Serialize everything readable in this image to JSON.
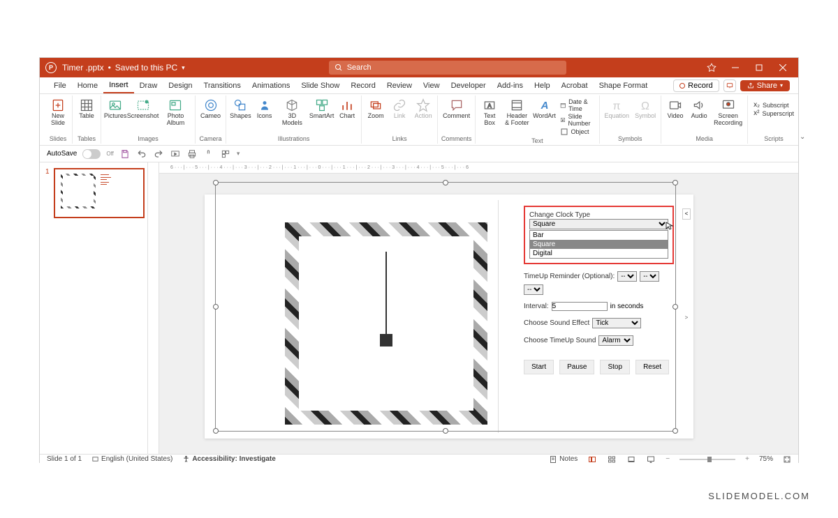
{
  "title": {
    "filename": "Timer .pptx",
    "saved": "Saved to this PC"
  },
  "search": {
    "placeholder": "Search"
  },
  "menu": {
    "file": "File",
    "home": "Home",
    "insert": "Insert",
    "draw": "Draw",
    "design": "Design",
    "transitions": "Transitions",
    "animations": "Animations",
    "slideshow": "Slide Show",
    "record": "Record",
    "review": "Review",
    "view": "View",
    "developer": "Developer",
    "addins": "Add-ins",
    "help": "Help",
    "acrobat": "Acrobat",
    "shapeformat": "Shape Format",
    "recordbtn": "Record",
    "share": "Share"
  },
  "ribbon": {
    "slides": {
      "newslide": "New\nSlide",
      "group": "Slides"
    },
    "tables": {
      "table": "Table",
      "group": "Tables"
    },
    "images": {
      "pictures": "Pictures",
      "screenshot": "Screenshot",
      "photoalbum": "Photo\nAlbum",
      "group": "Images"
    },
    "camera": {
      "cameo": "Cameo",
      "group": "Camera"
    },
    "illustrations": {
      "shapes": "Shapes",
      "icons": "Icons",
      "models": "3D\nModels",
      "smartart": "SmartArt",
      "chart": "Chart",
      "group": "Illustrations"
    },
    "links": {
      "zoom": "Zoom",
      "link": "Link",
      "action": "Action",
      "group": "Links"
    },
    "comments": {
      "comment": "Comment",
      "group": "Comments"
    },
    "text": {
      "textbox": "Text\nBox",
      "headerfooter": "Header\n& Footer",
      "wordart": "WordArt",
      "datetime": "Date & Time",
      "slidenumber": "Slide Number",
      "object": "Object",
      "group": "Text"
    },
    "symbols": {
      "equation": "Equation",
      "symbol": "Symbol",
      "group": "Symbols"
    },
    "media": {
      "video": "Video",
      "audio": "Audio",
      "screenrec": "Screen\nRecording",
      "group": "Media"
    },
    "scripts": {
      "subscript": "Subscript",
      "superscript": "Superscript",
      "group": "Scripts"
    }
  },
  "qat": {
    "autosave": "AutoSave",
    "off": "Off"
  },
  "ruler": "6 · · · | · · · 5 · · · | · · · 4 · · · | · · · 3 · · · | · · · 2 · · · | · · · 1 · · · | · · · 0 · · · | · · · 1 · · · | · · · 2 · · · | · · · 3 · · · | · · · 4 · · · | · · · 5 · · · | · · · 6",
  "panel": {
    "change_clock": "Change Clock Type",
    "clock_selected": "Square",
    "options": {
      "bar": "Bar",
      "square": "Square",
      "digital": "Digital"
    },
    "timeup_reminder": "TimeUp Reminder (Optional):",
    "dash": "--",
    "interval_lbl": "Interval:",
    "interval_val": "5",
    "interval_unit": "in seconds",
    "sound_lbl": "Choose Sound Effect",
    "sound_val": "Tick",
    "timeup_sound_lbl": "Choose TimeUp Sound",
    "timeup_sound_val": "Alarm",
    "start": "Start",
    "pause": "Pause",
    "stop": "Stop",
    "reset": "Reset"
  },
  "status": {
    "slide": "Slide 1 of 1",
    "lang": "English (United States)",
    "accessibility": "Accessibility: Investigate",
    "notes": "Notes",
    "zoom": "75%"
  },
  "thumb_num": "1",
  "watermark": "SLIDEMODEL.COM"
}
